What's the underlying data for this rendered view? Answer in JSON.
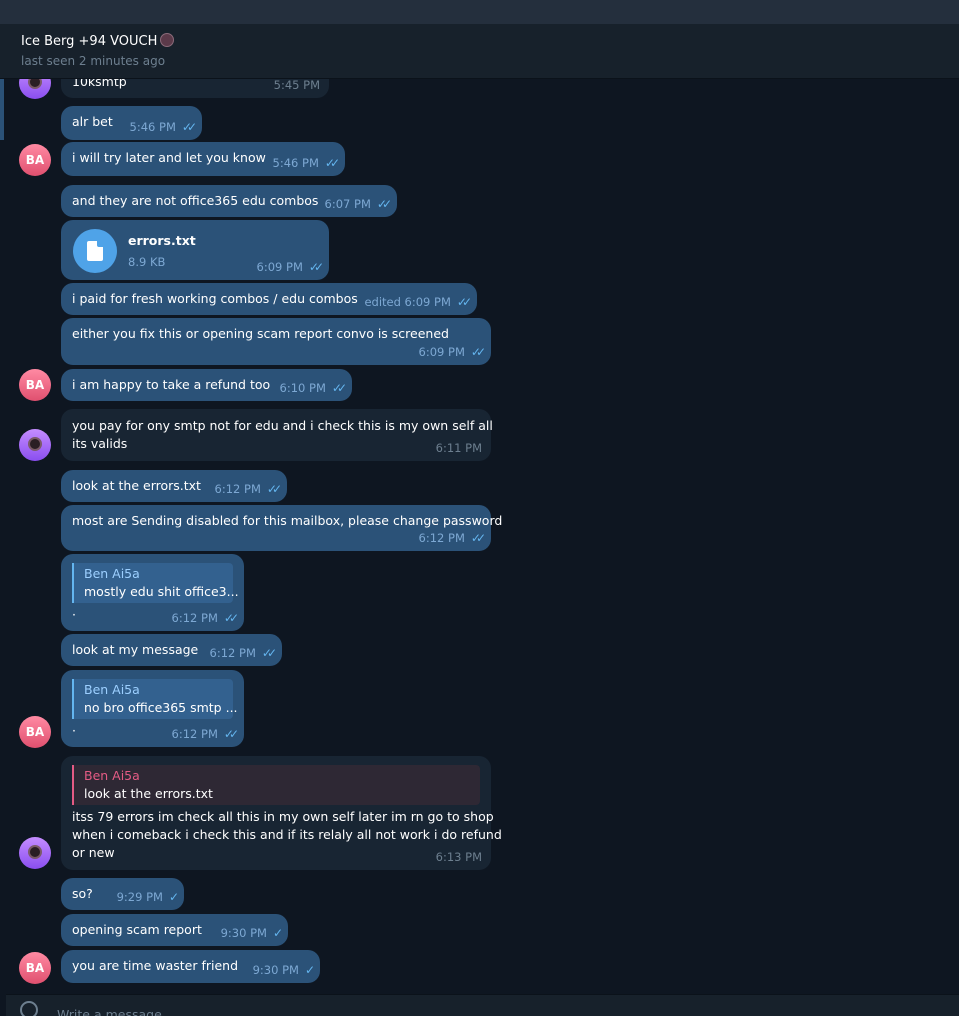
{
  "header": {
    "title": "Ice Berg +94 VOUCH",
    "status": "last seen 2 minutes ago"
  },
  "avatars": {
    "ba_initials": "BA"
  },
  "messages": [
    {
      "text": "10ksmtp",
      "time": "5:45 PM"
    },
    {
      "text": "alr bet",
      "time": "5:46 PM"
    },
    {
      "text": "i will try later and let you know",
      "time": "5:46 PM"
    },
    {
      "text": "and they are not office365 edu combos",
      "time": "6:07 PM"
    },
    {
      "file_name": "errors.txt",
      "file_size": "8.9 KB",
      "time": "6:09 PM"
    },
    {
      "text": "i paid for fresh working combos / edu combos",
      "time": "edited 6:09 PM"
    },
    {
      "text": "either you fix this or opening scam report convo is screened",
      "time": "6:09 PM"
    },
    {
      "text": "i am happy to take a refund too",
      "time": "6:10 PM"
    },
    {
      "line1": "you pay for ony smtp  not for edu and i check this is my own self all",
      "line2": "its valids",
      "time": "6:11 PM"
    },
    {
      "text": "look at the errors.txt",
      "time": "6:12 PM"
    },
    {
      "text": "most are Sending disabled for this mailbox, please change password",
      "time": "6:12 PM"
    },
    {
      "reply_name": "Ben Ai5a",
      "reply_text": "mostly edu shit office3...",
      "text": "·",
      "time": "6:12 PM"
    },
    {
      "text": "look at my message",
      "time": "6:12 PM"
    },
    {
      "reply_name": "Ben Ai5a",
      "reply_text": "no bro office365 smtp ...",
      "text": "·",
      "time": "6:12 PM"
    },
    {
      "reply_name": "Ben Ai5a",
      "reply_text": "look at the errors.txt",
      "line1": "itss 79 errors im check all this in my own self later im rn go to shop",
      "line2": "when i comeback i check this and if its relaly all not work i do refund",
      "line3": "or new",
      "time": "6:13 PM"
    },
    {
      "text": "so?",
      "time": "9:29 PM"
    },
    {
      "text": "opening scam report",
      "time": "9:30 PM"
    },
    {
      "text": "you are time waster friend",
      "time": "9:30 PM"
    }
  ],
  "composer": {
    "placeholder": "Write a message..."
  },
  "colors": {
    "background": "#0e1621",
    "outgoing_bubble": "#2b5278",
    "incoming_bubble": "#182533",
    "accent": "#64b5ef",
    "reply_accent_incoming": "#e45b84"
  }
}
